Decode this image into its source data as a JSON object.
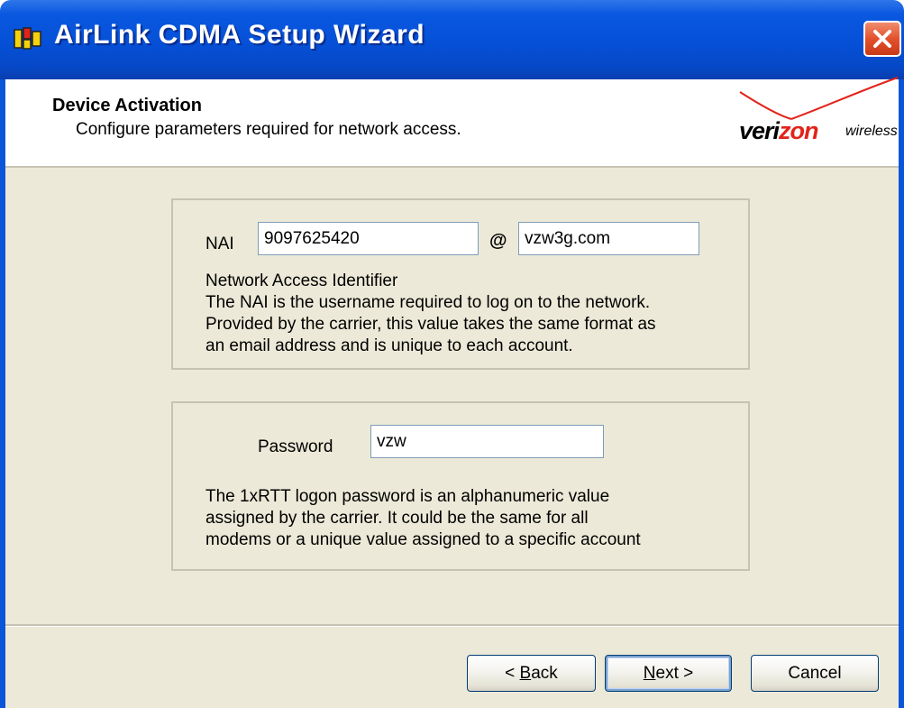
{
  "window": {
    "title": "AirLink CDMA Setup Wizard"
  },
  "header": {
    "title": "Device Activation",
    "subtitle": "Configure parameters required for network access.",
    "logo": {
      "brand_prefix": "veri",
      "brand_accent": "zon",
      "brand_suffix": "wireless",
      "accent_color": "#e2231a"
    }
  },
  "nai": {
    "label": "NAI",
    "username": "9097625420",
    "at_symbol": "@",
    "domain": "vzw3g.com",
    "description": [
      "Network Access Identifier",
      "The NAI is the username required to log on to the network.",
      "Provided by the carrier, this value takes the same format as",
      "an email address and is unique to each account."
    ]
  },
  "password": {
    "label": "Password",
    "value": "vzw",
    "description": [
      "The 1xRTT logon password is an alphanumeric value",
      "assigned by the carrier. It could be the same for all",
      "modems or a unique value assigned to a specific account"
    ]
  },
  "buttons": {
    "back": {
      "prefix": "< ",
      "mnemonic": "B",
      "rest": "ack"
    },
    "next": {
      "mnemonic": "N",
      "rest": "ext >"
    },
    "cancel": "Cancel"
  }
}
